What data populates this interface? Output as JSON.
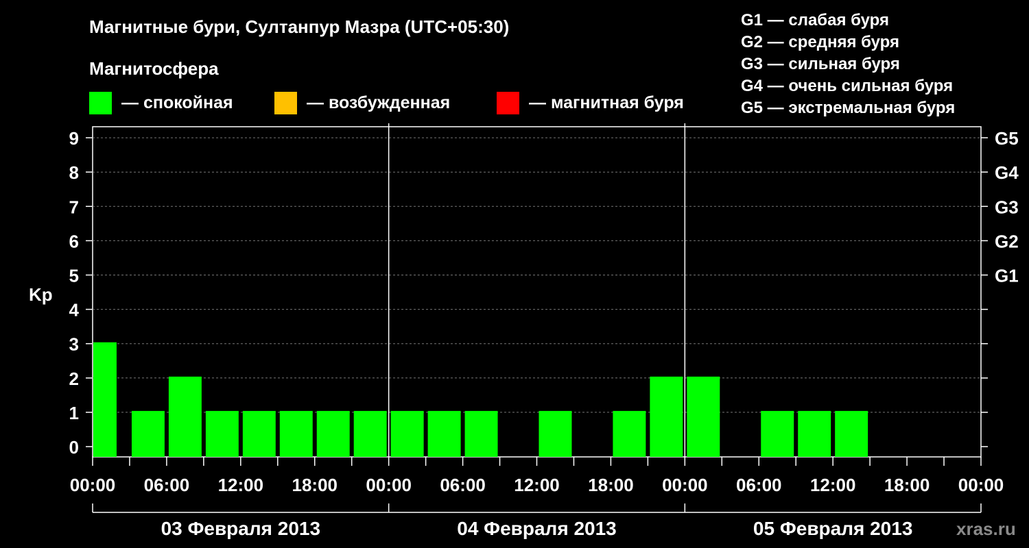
{
  "header": {
    "title": "Магнитные бури, Султанпур Мазра (UTC+05:30)",
    "legend_title": "Магнитосфера",
    "status_legend": [
      {
        "label": "— спокойная",
        "color": "#00ff00"
      },
      {
        "label": "— возбужденная",
        "color": "#ffc000"
      },
      {
        "label": "— магнитная буря",
        "color": "#ff0000"
      }
    ],
    "storm_scale": [
      "G1 — слабая буря",
      "G2 — средняя буря",
      "G3 — сильная буря",
      "G4 — очень сильная буря",
      "G5 — экстремальная буря"
    ]
  },
  "chart_data": {
    "type": "bar",
    "ylabel": "Kp",
    "ylim": [
      0,
      9
    ],
    "y_ticks": [
      "0",
      "1",
      "2",
      "3",
      "4",
      "5",
      "6",
      "7",
      "8",
      "9"
    ],
    "right_ticks": [
      {
        "kp": 5,
        "label": "G1"
      },
      {
        "kp": 6,
        "label": "G2"
      },
      {
        "kp": 7,
        "label": "G3"
      },
      {
        "kp": 8,
        "label": "G4"
      },
      {
        "kp": 9,
        "label": "G5"
      }
    ],
    "x_tick_labels": [
      "00:00",
      "06:00",
      "12:00",
      "18:00",
      "00:00",
      "06:00",
      "12:00",
      "18:00",
      "00:00",
      "06:00",
      "12:00",
      "18:00",
      "00:00"
    ],
    "days": [
      "03 Февраля 2013",
      "04 Февраля 2013",
      "05 Февраля 2013"
    ],
    "interval_hours": 3,
    "kp_values": [
      3,
      1,
      2,
      1,
      1,
      1,
      1,
      1,
      1,
      1,
      1,
      0,
      1,
      0,
      1,
      2,
      2,
      0,
      1,
      1,
      1,
      0,
      0,
      0
    ],
    "bar_color": "#00ff00",
    "grid": true
  },
  "watermark": "xras.ru"
}
